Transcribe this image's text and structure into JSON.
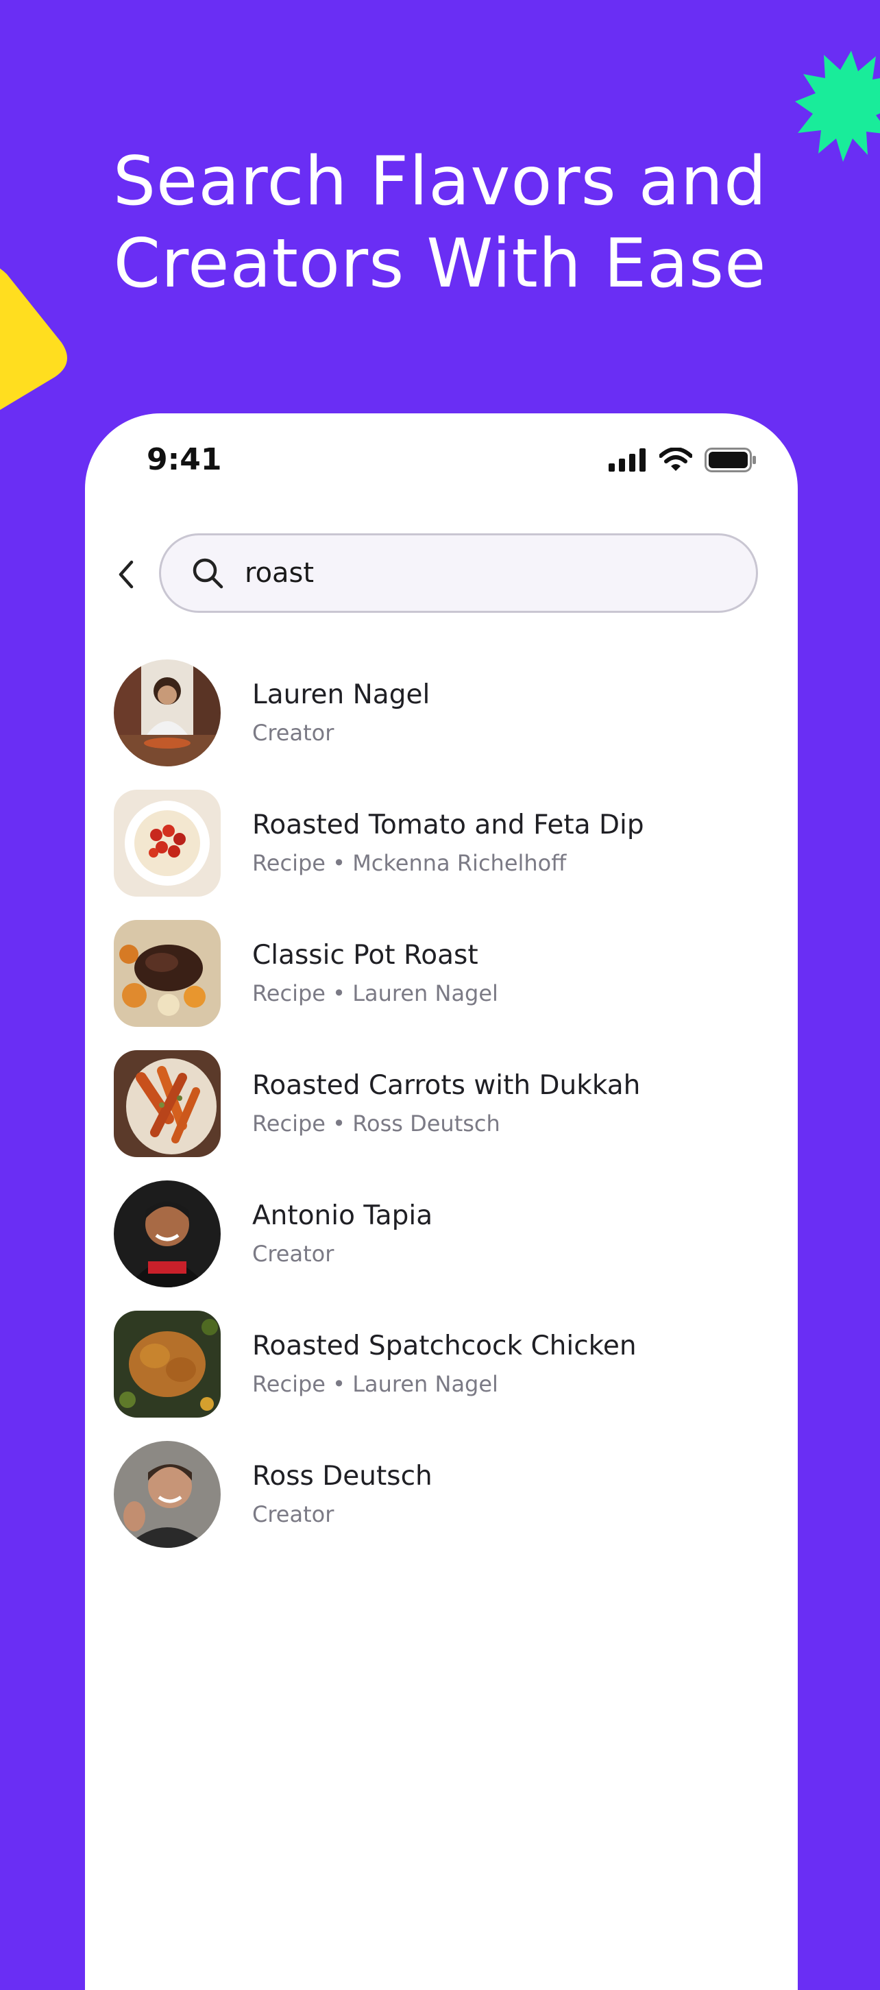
{
  "headline": {
    "line1": "Search Flavors and",
    "line2": "Creators With Ease"
  },
  "colors": {
    "background": "#6a2ef4",
    "accent_green": "#19ec9a",
    "accent_yellow": "#ffde1f"
  },
  "status_bar": {
    "time": "9:41"
  },
  "search": {
    "value": "roast"
  },
  "results": [
    {
      "title": "Lauren Nagel",
      "subtitle": "Creator",
      "thumb": "person-avatar"
    },
    {
      "title": "Roasted Tomato and Feta Dip",
      "subtitle": "Recipe • Mckenna Richelhoff",
      "thumb": "recipe-photo"
    },
    {
      "title": "Classic Pot Roast",
      "subtitle": "Recipe • Lauren Nagel",
      "thumb": "recipe-photo"
    },
    {
      "title": "Roasted Carrots with Dukkah",
      "subtitle": "Recipe • Ross Deutsch",
      "thumb": "recipe-photo"
    },
    {
      "title": "Antonio Tapia",
      "subtitle": "Creator",
      "thumb": "person-avatar"
    },
    {
      "title": "Roasted Spatchcock Chicken",
      "subtitle": "Recipe • Lauren Nagel",
      "thumb": "recipe-photo"
    },
    {
      "title": "Ross Deutsch",
      "subtitle": "Creator",
      "thumb": "person-avatar"
    }
  ]
}
